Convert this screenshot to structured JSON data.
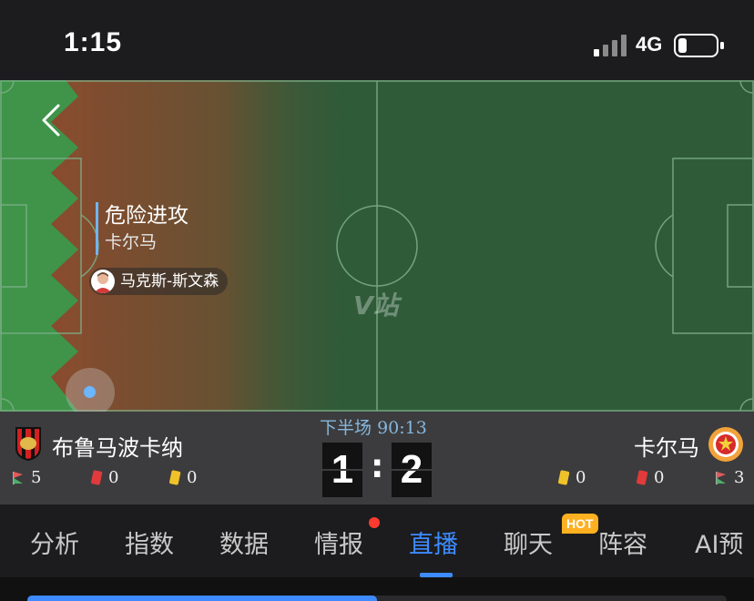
{
  "status_bar": {
    "time": "1:15",
    "network": "4G"
  },
  "pitch": {
    "event_title": "危险进攻",
    "event_team": "卡尔马",
    "player_name": "马克斯-斯文森",
    "watermark": "V站"
  },
  "scoreboard": {
    "period": "下半场",
    "clock": "90:13",
    "home": {
      "name": "布鲁马波卡纳",
      "score": "1",
      "corners": "5",
      "red_cards": "0",
      "yellow_cards": "0"
    },
    "away": {
      "name": "卡尔马",
      "score": "2",
      "corners": "3",
      "red_cards": "0",
      "yellow_cards": "0"
    },
    "separator": ":"
  },
  "tabs": {
    "items": [
      "分析",
      "指数",
      "数据",
      "情报",
      "直播",
      "聊天",
      "阵容",
      "AI预"
    ],
    "active": "直播",
    "hot_badge": "HOT"
  },
  "progress_fraction": 0.5,
  "colors": {
    "accent": "#3d8bff",
    "pitch": "#2f5b39",
    "danger_zone": "#8a4a2e",
    "red_dot": "#ff3b30",
    "hot": "#ffb020"
  }
}
